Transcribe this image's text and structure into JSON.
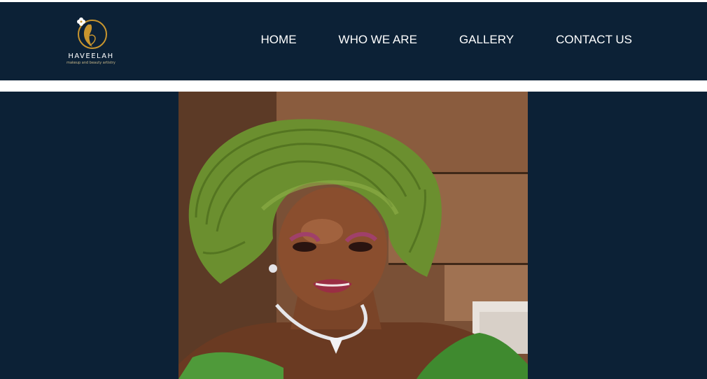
{
  "brand": {
    "name": "HAVEELAH",
    "tagline": "makeup and beauty artistry",
    "logo_icon": "woman-profile-flower-logo"
  },
  "nav": {
    "items": [
      {
        "label": "HOME"
      },
      {
        "label": "WHO WE ARE"
      },
      {
        "label": "GALLERY"
      },
      {
        "label": "CONTACT US"
      }
    ]
  },
  "hero": {
    "image": "portrait-woman-green-gele-headwrap"
  },
  "colors": {
    "header_bg": "#0c2136",
    "nav_text": "#ffffff",
    "logo_gold": "#c8952e",
    "gele_green": "#6b8f2f"
  }
}
